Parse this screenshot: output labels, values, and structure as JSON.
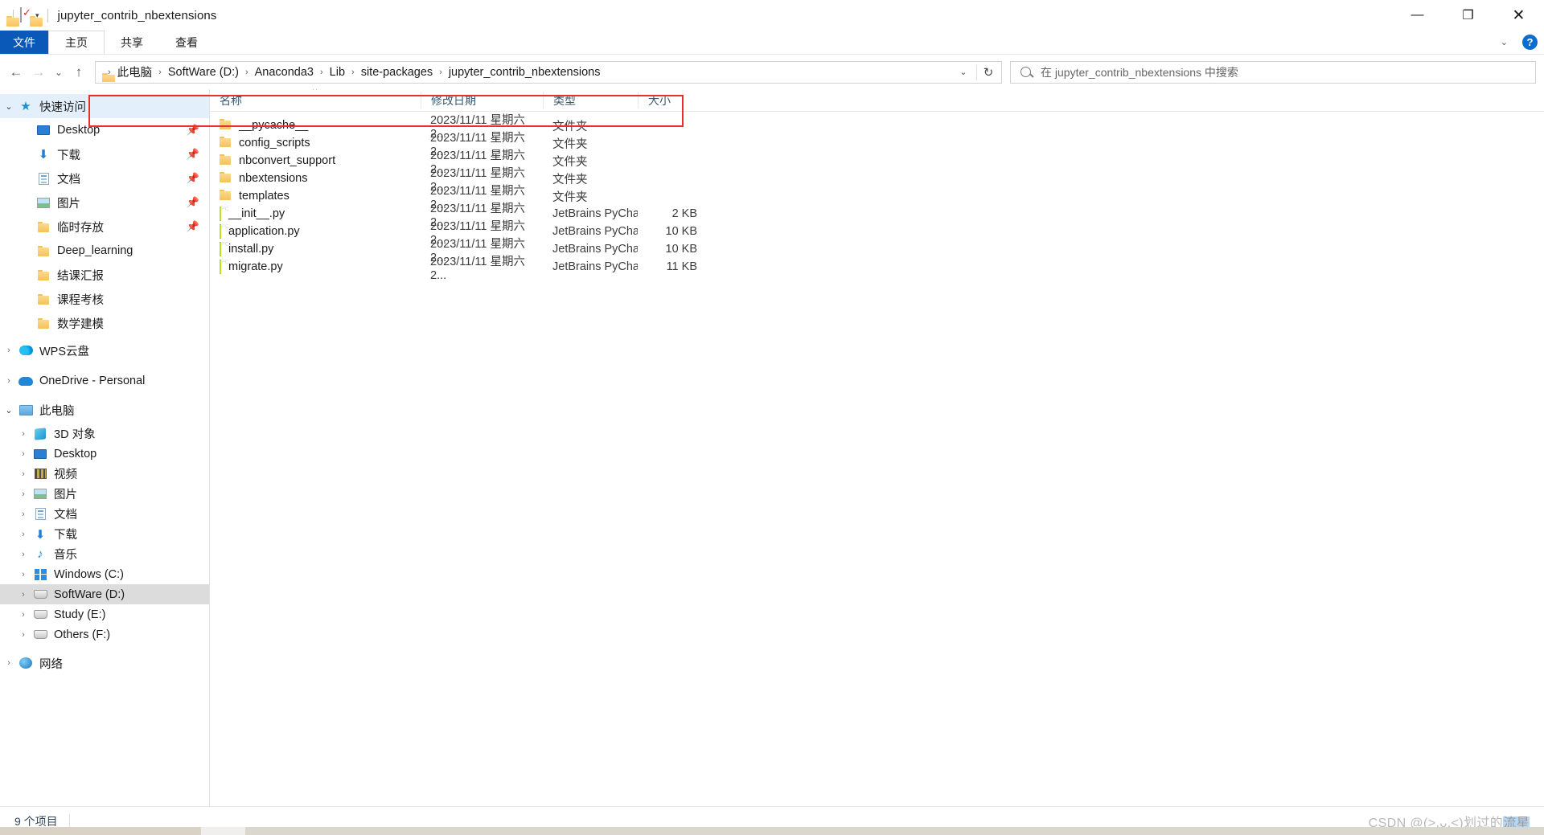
{
  "window": {
    "title": "jupyter_contrib_nbextensions",
    "quick_access_icons": [
      "folder-icon",
      "properties-icon",
      "new-folder-icon",
      "customize-chevron-icon"
    ],
    "controls": {
      "minimize": "—",
      "maximize": "❐",
      "close": "✕"
    }
  },
  "ribbon": {
    "tabs": [
      {
        "label": "文件",
        "kind": "file"
      },
      {
        "label": "主页",
        "kind": "active"
      },
      {
        "label": "共享",
        "kind": "normal"
      },
      {
        "label": "查看",
        "kind": "normal"
      }
    ],
    "collapse_icon": "chevron-down-icon",
    "help_label": "?"
  },
  "navbar": {
    "back": "←",
    "forward": "→",
    "recent": "⌄",
    "up": "↑",
    "breadcrumb_icon": "folder-icon",
    "breadcrumbs": [
      "此电脑",
      "SoftWare (D:)",
      "Anaconda3",
      "Lib",
      "site-packages",
      "jupyter_contrib_nbextensions"
    ],
    "separator": "›",
    "dropdown_icon": "chevron-down-icon",
    "refresh_icon": "↻",
    "search_icon": "search-icon",
    "search_placeholder": "在 jupyter_contrib_nbextensions 中搜索",
    "highlight_color": "#e8302a"
  },
  "sidebar": {
    "items": [
      {
        "label": "快速访问",
        "twisty": "⌄",
        "icon": "star-pin-icon",
        "indent": 0,
        "state": "selected-light",
        "pin": false
      },
      {
        "label": "Desktop",
        "twisty": "",
        "icon": "desktop-icon",
        "indent": 1,
        "state": "",
        "pin": true
      },
      {
        "label": "下载",
        "twisty": "",
        "icon": "downloads-icon",
        "indent": 1,
        "state": "",
        "pin": true
      },
      {
        "label": "文档",
        "twisty": "",
        "icon": "documents-icon",
        "indent": 1,
        "state": "",
        "pin": true
      },
      {
        "label": "图片",
        "twisty": "",
        "icon": "pictures-icon",
        "indent": 1,
        "state": "",
        "pin": true
      },
      {
        "label": "临时存放",
        "twisty": "",
        "icon": "folder-icon",
        "indent": 1,
        "state": "",
        "pin": true
      },
      {
        "label": "Deep_learning",
        "twisty": "",
        "icon": "folder-icon",
        "indent": 1,
        "state": "",
        "pin": false
      },
      {
        "label": "结课汇报",
        "twisty": "",
        "icon": "folder-icon",
        "indent": 1,
        "state": "",
        "pin": false
      },
      {
        "label": "课程考核",
        "twisty": "",
        "icon": "folder-icon",
        "indent": 1,
        "state": "",
        "pin": false
      },
      {
        "label": "数学建模",
        "twisty": "",
        "icon": "folder-icon",
        "indent": 1,
        "state": "",
        "pin": false
      },
      {
        "label": "WPS云盘",
        "twisty": "›",
        "icon": "wps-cloud-icon",
        "indent": 0,
        "state": "",
        "pin": false
      },
      {
        "label": "OneDrive - Personal",
        "twisty": "›",
        "icon": "onedrive-icon",
        "indent": 0,
        "state": "",
        "pin": false
      },
      {
        "label": "此电脑",
        "twisty": "⌄",
        "icon": "this-pc-icon",
        "indent": 0,
        "state": "",
        "pin": false
      },
      {
        "label": "3D 对象",
        "twisty": "›",
        "icon": "3d-objects-icon",
        "indent": 1,
        "state": "",
        "pin": false
      },
      {
        "label": "Desktop",
        "twisty": "›",
        "icon": "desktop-icon",
        "indent": 1,
        "state": "",
        "pin": false
      },
      {
        "label": "视频",
        "twisty": "›",
        "icon": "videos-icon",
        "indent": 1,
        "state": "",
        "pin": false
      },
      {
        "label": "图片",
        "twisty": "›",
        "icon": "pictures-icon",
        "indent": 1,
        "state": "",
        "pin": false
      },
      {
        "label": "文档",
        "twisty": "›",
        "icon": "documents-icon",
        "indent": 1,
        "state": "",
        "pin": false
      },
      {
        "label": "下载",
        "twisty": "›",
        "icon": "downloads-icon",
        "indent": 1,
        "state": "",
        "pin": false
      },
      {
        "label": "音乐",
        "twisty": "›",
        "icon": "music-icon",
        "indent": 1,
        "state": "",
        "pin": false
      },
      {
        "label": "Windows (C:)",
        "twisty": "›",
        "icon": "windows-drive-icon",
        "indent": 1,
        "state": "",
        "pin": false
      },
      {
        "label": "SoftWare (D:)",
        "twisty": "›",
        "icon": "drive-icon",
        "indent": 1,
        "state": "selected-gray",
        "pin": false
      },
      {
        "label": "Study (E:)",
        "twisty": "›",
        "icon": "drive-icon",
        "indent": 1,
        "state": "",
        "pin": false
      },
      {
        "label": "Others (F:)",
        "twisty": "›",
        "icon": "drive-icon",
        "indent": 1,
        "state": "",
        "pin": false
      },
      {
        "label": "网络",
        "twisty": "›",
        "icon": "network-icon",
        "indent": 0,
        "state": "",
        "pin": false
      }
    ]
  },
  "filelist": {
    "columns": [
      {
        "key": "name",
        "label": "名称",
        "sorted": true,
        "sort_arrow": "^"
      },
      {
        "key": "date",
        "label": "修改日期"
      },
      {
        "key": "type",
        "label": "类型"
      },
      {
        "key": "size",
        "label": "大小"
      }
    ],
    "rows": [
      {
        "name": "__pycache__",
        "date": "2023/11/11 星期六 2...",
        "type": "文件夹",
        "size": "",
        "icon": "folder-icon"
      },
      {
        "name": "config_scripts",
        "date": "2023/11/11 星期六 2...",
        "type": "文件夹",
        "size": "",
        "icon": "folder-icon"
      },
      {
        "name": "nbconvert_support",
        "date": "2023/11/11 星期六 2...",
        "type": "文件夹",
        "size": "",
        "icon": "folder-icon"
      },
      {
        "name": "nbextensions",
        "date": "2023/11/11 星期六 2...",
        "type": "文件夹",
        "size": "",
        "icon": "folder-icon"
      },
      {
        "name": "templates",
        "date": "2023/11/11 星期六 2...",
        "type": "文件夹",
        "size": "",
        "icon": "folder-icon"
      },
      {
        "name": "__init__.py",
        "date": "2023/11/11 星期六 2...",
        "type": "JetBrains PyChar...",
        "size": "2 KB",
        "icon": "pycharm-file-icon"
      },
      {
        "name": "application.py",
        "date": "2023/11/11 星期六 2...",
        "type": "JetBrains PyChar...",
        "size": "10 KB",
        "icon": "pycharm-file-icon"
      },
      {
        "name": "install.py",
        "date": "2023/11/11 星期六 2...",
        "type": "JetBrains PyChar...",
        "size": "10 KB",
        "icon": "pycharm-file-icon"
      },
      {
        "name": "migrate.py",
        "date": "2023/11/11 星期六 2...",
        "type": "JetBrains PyChar...",
        "size": "11 KB",
        "icon": "pycharm-file-icon"
      }
    ]
  },
  "statusbar": {
    "item_count": "9 个项目",
    "watermark_prefix": "CSDN @(>.ᴗ.<)划过的",
    "watermark_highlight": "流星"
  }
}
